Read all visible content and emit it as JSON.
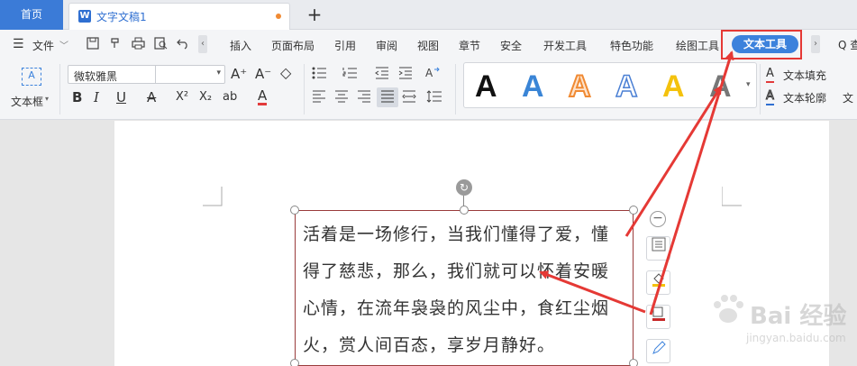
{
  "titlebar": {
    "home_tab": "首页",
    "doc_tab_icon": "W",
    "doc_tab_title": "文字文稿1",
    "new_tab_symbol": "+"
  },
  "menubar": {
    "menu_glyph": "☰",
    "file_label": "文件",
    "file_caret": "﹀",
    "scroll_left": "‹",
    "scroll_right": "›",
    "tabs": [
      "插入",
      "页面布局",
      "引用",
      "审阅",
      "视图",
      "章节",
      "安全",
      "开发工具",
      "特色功能",
      "绘图工具"
    ],
    "active_tab": "文本工具",
    "search_partial": "Q 查"
  },
  "ribbon": {
    "textbox_label": "文本框",
    "textbox_caret": "▾",
    "font_name": "微软雅黑",
    "font_caret": "▾",
    "font_size_up": "A⁺",
    "font_size_down": "A⁻",
    "clear_format": "◇",
    "bold": "B",
    "italic": "I",
    "underline": "U",
    "strike": "A",
    "superscript": "X²",
    "subscript": "X₂",
    "phonetic": "ab",
    "font_color": "A",
    "gallery_caret": "▾",
    "fill_label": "文本填充",
    "outline_label": "文本轮廓",
    "effects_partial": "文",
    "style_glyph": "A"
  },
  "textbox": {
    "lines": [
      "活着是一场修行，当我们懂得了爱，懂",
      "得了慈悲，那么，我们就可以怀着安暖",
      "心情，在流年袅袅的风尘中，食红尘烟",
      "火，赏人间百态，享岁月静好。"
    ],
    "rotate_glyph": "↻"
  },
  "float_tools": {
    "collapse": "−"
  },
  "watermark": {
    "brand": "Bai 经验",
    "url": "jingyan.baidu.com"
  },
  "colors": {
    "accent_blue": "#3c82dc",
    "highlight_red": "#e53935",
    "style_black": "#111111",
    "style_blue": "#3a85d6",
    "style_orange": "#f08a33",
    "style_outline_blue": "#4a7fd4",
    "style_yellow": "#f4c20d",
    "style_gray": "#777777"
  }
}
